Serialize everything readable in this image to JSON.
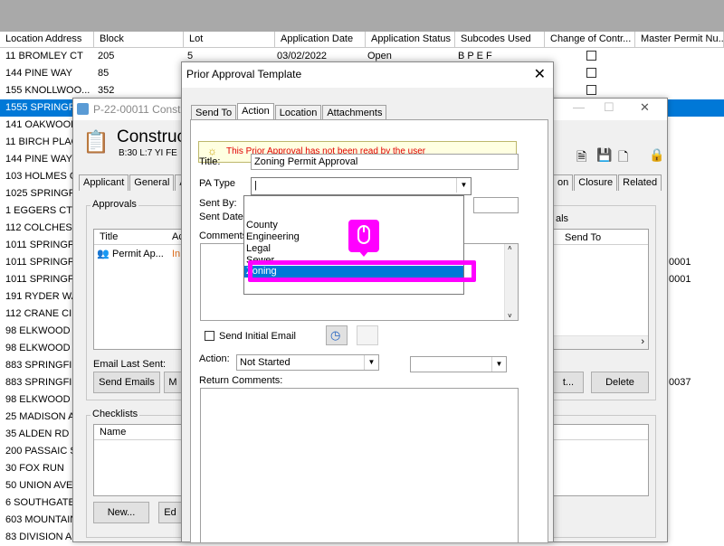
{
  "grid": {
    "columns": [
      "Location Address",
      "Block",
      "Lot",
      "Application Date",
      "Application Status",
      "Subcodes Used",
      "Change of Contr...",
      "Master Permit Nu..."
    ],
    "rows": [
      {
        "address": "11 BROMLEY CT",
        "block": "205",
        "lot": "5",
        "date": "03/02/2022",
        "status": "Open",
        "subcodes": "B P E F"
      },
      {
        "address": "144 PINE WAY",
        "block": "85",
        "lot": "",
        "date": "",
        "status": "",
        "subcodes": ""
      },
      {
        "address": "155 KNOLLWOO...",
        "block": "352",
        "lot": "",
        "date": "",
        "status": "",
        "subcodes": ""
      },
      {
        "address": "1555 SPRINGF",
        "block": "",
        "lot": "",
        "date": "",
        "status": "",
        "subcodes": ""
      },
      {
        "address": "141 OAKWOOD",
        "block": "",
        "lot": "",
        "date": "",
        "status": "",
        "subcodes": ""
      },
      {
        "address": "11 BIRCH PLAC",
        "block": "",
        "lot": "",
        "date": "",
        "status": "",
        "subcodes": ""
      },
      {
        "address": "144 PINE WAY",
        "block": "",
        "lot": "",
        "date": "",
        "status": "",
        "subcodes": ""
      },
      {
        "address": "103 HOLMES O",
        "block": "",
        "lot": "",
        "date": "",
        "status": "",
        "subcodes": ""
      },
      {
        "address": "1025 SPRINGF",
        "block": "",
        "lot": "",
        "date": "",
        "status": "",
        "subcodes": ""
      },
      {
        "address": "1 EGGERS CT",
        "block": "",
        "lot": "",
        "date": "",
        "status": "",
        "subcodes": ""
      },
      {
        "address": "112 COLCHEST",
        "block": "",
        "lot": "",
        "date": "",
        "status": "",
        "subcodes": ""
      },
      {
        "address": "1011 SPRINGF",
        "block": "",
        "lot": "",
        "date": "",
        "status": "",
        "subcodes": ""
      },
      {
        "address": "1011 SPRINGF",
        "block": "",
        "lot": "",
        "date": "",
        "status": "",
        "subcodes": ""
      },
      {
        "address": "1011 SPRINGF",
        "block": "",
        "lot": "",
        "date": "",
        "status": "",
        "subcodes": ""
      },
      {
        "address": "191 RYDER WA",
        "block": "",
        "lot": "",
        "date": "",
        "status": "",
        "subcodes": ""
      },
      {
        "address": "112 CRANE CIR",
        "block": "",
        "lot": "",
        "date": "",
        "status": "",
        "subcodes": ""
      },
      {
        "address": "98 ELKWOOD A",
        "block": "",
        "lot": "",
        "date": "",
        "status": "",
        "subcodes": ""
      },
      {
        "address": "98 ELKWOOD A",
        "block": "",
        "lot": "",
        "date": "",
        "status": "",
        "subcodes": ""
      },
      {
        "address": "883 SPRINGFIE",
        "block": "",
        "lot": "",
        "date": "",
        "status": "",
        "subcodes": ""
      },
      {
        "address": "883 SPRINGFIE",
        "block": "",
        "lot": "",
        "date": "",
        "status": "",
        "subcodes": ""
      },
      {
        "address": "98 ELKWOOD A",
        "block": "",
        "lot": "",
        "date": "",
        "status": "",
        "subcodes": ""
      },
      {
        "address": "25 MADISON A",
        "block": "",
        "lot": "",
        "date": "",
        "status": "",
        "subcodes": ""
      },
      {
        "address": "35 ALDEN RD",
        "block": "",
        "lot": "",
        "date": "",
        "status": "",
        "subcodes": ""
      },
      {
        "address": "200 PASSAIC S",
        "block": "",
        "lot": "",
        "date": "",
        "status": "",
        "subcodes": ""
      },
      {
        "address": "30 FOX RUN",
        "block": "",
        "lot": "",
        "date": "",
        "status": "",
        "subcodes": ""
      },
      {
        "address": "50 UNION AVE",
        "block": "",
        "lot": "",
        "date": "",
        "status": "",
        "subcodes": ""
      },
      {
        "address": "6 SOUTHGATE",
        "block": "",
        "lot": "",
        "date": "",
        "status": "",
        "subcodes": ""
      },
      {
        "address": "603 MOUNTAIN",
        "block": "",
        "lot": "",
        "date": "",
        "status": "",
        "subcodes": ""
      },
      {
        "address": "83 DIVISION A",
        "block": "",
        "lot": "",
        "date": "",
        "status": "",
        "subcodes": ""
      }
    ],
    "right_edge_values": [
      "0001",
      "0001",
      "0037"
    ]
  },
  "construction_window": {
    "title": "P-22-00011 Constr",
    "header_title": "Construc",
    "header_sub": "B:30 L:7  YI FE",
    "tabs_left": [
      "Applicant",
      "General",
      "A"
    ],
    "tabs_right": [
      "on",
      "Closure",
      "Related"
    ],
    "approvals_label": "Approvals",
    "approvals_cols": [
      "Title",
      "Ac"
    ],
    "approval_row": {
      "title": "Permit Ap...",
      "status": "In"
    },
    "right_panel_label": "als",
    "right_panel_cols": [
      "Send To"
    ],
    "email_last_sent": "Email Last Sent:",
    "send_emails": "Send Emails",
    "btn_m": "M",
    "btn_t": "t...",
    "delete": "Delete",
    "checklists_label": "Checklists",
    "checklists_col": "Name",
    "new_btn": "New...",
    "ed_btn": "Ed"
  },
  "dialog": {
    "title": "Prior Approval Template",
    "tabs": [
      "Send To",
      "Action",
      "Location",
      "Attachments"
    ],
    "active_tab": "Action",
    "warning": "This Prior Approval has not been read by the user",
    "title_label": "Title:",
    "title_value": "Zoning Permit Approval",
    "pa_type_label": "PA Type",
    "pa_type_value": "|",
    "sent_by_label": "Sent By:",
    "sent_date_label": "Sent Date:",
    "comments_label": "Comments:",
    "dropdown_options": [
      "County",
      "Engineering",
      "Legal",
      "Sewer",
      "Zoning"
    ],
    "highlighted_option": "Zoning",
    "send_initial_email": "Send Initial Email",
    "action_label": "Action:",
    "action_value": "Not Started",
    "return_comments_label": "Return Comments:"
  },
  "colors": {
    "selection": "#0078d7",
    "highlight_magenta": "#ff00ff",
    "warning_text": "#e00000"
  }
}
